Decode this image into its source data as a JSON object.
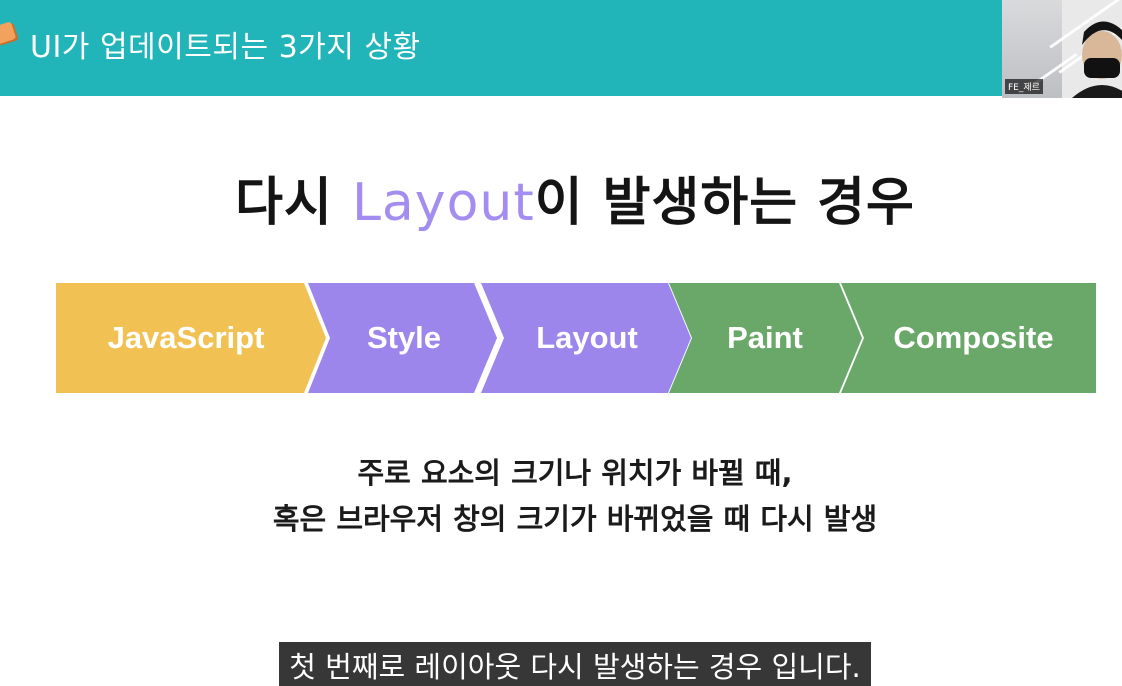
{
  "header": {
    "title": "UI가 업데이트되는 3가지 상황",
    "color": "#21b4b8"
  },
  "webcam": {
    "name_tag": "FE_제르"
  },
  "slide": {
    "title_prefix": "다시 ",
    "title_accent": "Layout",
    "title_suffix": "이 발생하는 경우",
    "accent_color": "#a48df0"
  },
  "pipeline": {
    "steps": [
      {
        "label": "JavaScript",
        "color": "#f2c153"
      },
      {
        "label": "Style",
        "color": "#9c86ec"
      },
      {
        "label": "Layout",
        "color": "#9c86ec"
      },
      {
        "label": "Paint",
        "color": "#6aa86a"
      },
      {
        "label": "Composite",
        "color": "#6aa86a"
      }
    ]
  },
  "body": {
    "line1": "주로 요소의 크기나 위치가 바뀔 때,",
    "line2": "혹은 브라우저 창의 크기가 바뀌었을 때 다시 발생"
  },
  "caption": {
    "text": "첫 번째로 레이아웃 다시 발생하는 경우 입니다."
  }
}
